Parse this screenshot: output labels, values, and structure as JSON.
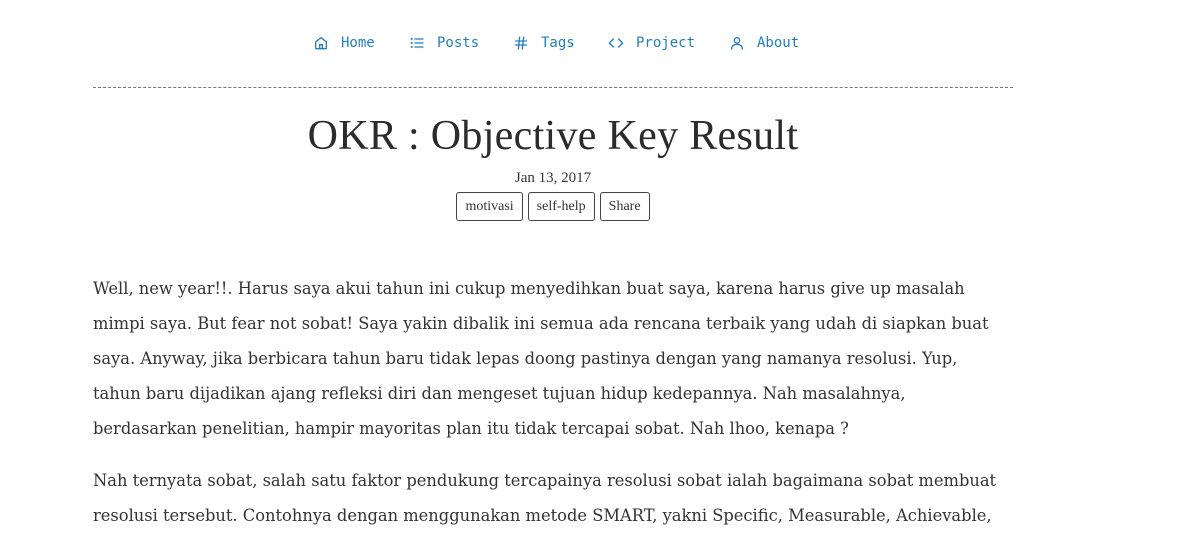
{
  "nav": {
    "items": [
      {
        "label": "Home",
        "icon": "home-icon"
      },
      {
        "label": "Posts",
        "icon": "list-icon"
      },
      {
        "label": "Tags",
        "icon": "hash-icon"
      },
      {
        "label": "Project",
        "icon": "code-icon"
      },
      {
        "label": "About",
        "icon": "user-icon"
      }
    ],
    "color": "#1e7fc2"
  },
  "post": {
    "title": "OKR : Objective Key Result",
    "date": "Jan 13, 2017",
    "tags": [
      "motivasi",
      "self-help"
    ],
    "share_label": "Share",
    "paragraphs": [
      "Well, new year!!. Harus saya akui tahun ini cukup menyedihkan buat saya, karena harus give up masalah mimpi saya. But fear not sobat! Saya yakin dibalik ini semua ada rencana terbaik yang udah di siapkan buat saya. Anyway, jika berbicara tahun baru tidak lepas doong pastinya dengan yang namanya resolusi. Yup, tahun baru dijadikan ajang refleksi diri dan mengeset tujuan hidup kedepannya. Nah masalahnya, berdasarkan penelitian, hampir mayoritas plan itu tidak tercapai sobat. Nah lhoo, kenapa ?",
      "Nah ternyata sobat, salah satu faktor pendukung tercapainya resolusi sobat ialah bagaimana sobat membuat resolusi tersebut. Contohnya dengan menggunakan metode SMART, yakni Specific, Measurable, Achievable,"
    ]
  }
}
